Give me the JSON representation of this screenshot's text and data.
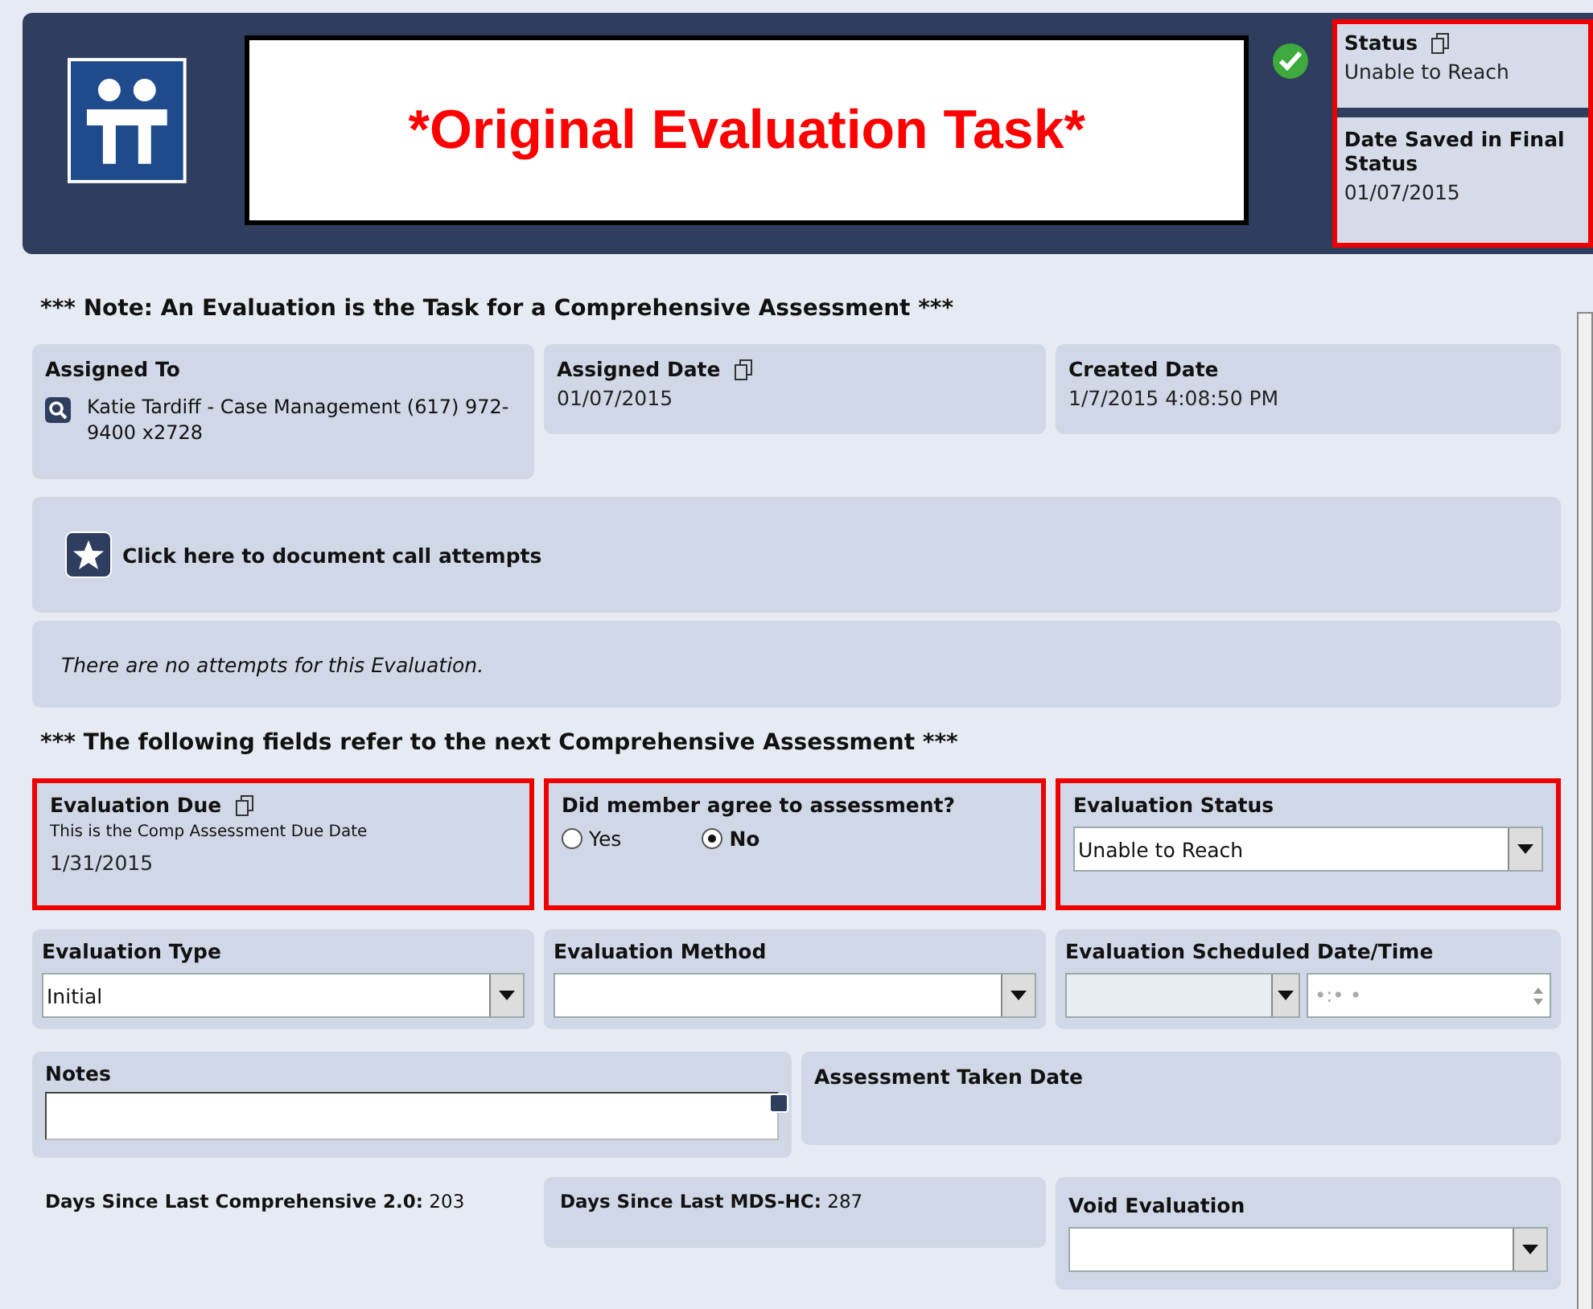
{
  "header": {
    "title": "*Original Evaluation Task*",
    "status_panel": {
      "highlighted": true,
      "status_label": "Status",
      "status_value": "Unable to Reach",
      "date_label": "Date Saved in Final Status",
      "date_value": "01/07/2015"
    }
  },
  "note": "*** Note: An Evaluation is the Task for a Comprehensive Assessment ***",
  "assigned_to": {
    "label": "Assigned To",
    "value": "Katie Tardiff - Case Management (617) 972-9400 x2728"
  },
  "assigned_date": {
    "label": "Assigned Date",
    "value": "01/07/2015"
  },
  "created_date": {
    "label": "Created Date",
    "value": "1/7/2015 4:08:50 PM"
  },
  "call_attempts_link": "Click here to document call attempts",
  "attempts_message": "There are no attempts for this Evaluation.",
  "section_note": "*** The following fields refer to the next Comprehensive Assessment ***",
  "evaluation_due": {
    "label": "Evaluation Due",
    "hint": "This is the Comp Assessment Due Date",
    "value": "1/31/2015",
    "highlighted": true
  },
  "member_agree": {
    "label": "Did member agree to assessment?",
    "highlighted": true,
    "options": [
      {
        "label": "Yes",
        "selected": false
      },
      {
        "label": "No",
        "selected": true
      }
    ]
  },
  "evaluation_status": {
    "label": "Evaluation Status",
    "value": "Unable to Reach",
    "highlighted": true
  },
  "evaluation_type": {
    "label": "Evaluation Type",
    "value": "Initial"
  },
  "evaluation_method": {
    "label": "Evaluation Method"
  },
  "scheduled": {
    "label": "Evaluation Scheduled Date/Time",
    "time_placeholder": "•:• •"
  },
  "notes": {
    "label": "Notes"
  },
  "assessment_taken_date": {
    "label": "Assessment Taken Date"
  },
  "days_comprehensive": {
    "label": "Days Since Last Comprehensive 2.0:",
    "value": "203"
  },
  "days_mds": {
    "label": "Days Since Last MDS-HC:",
    "value": "287"
  },
  "void_evaluation": {
    "label": "Void Evaluation"
  }
}
